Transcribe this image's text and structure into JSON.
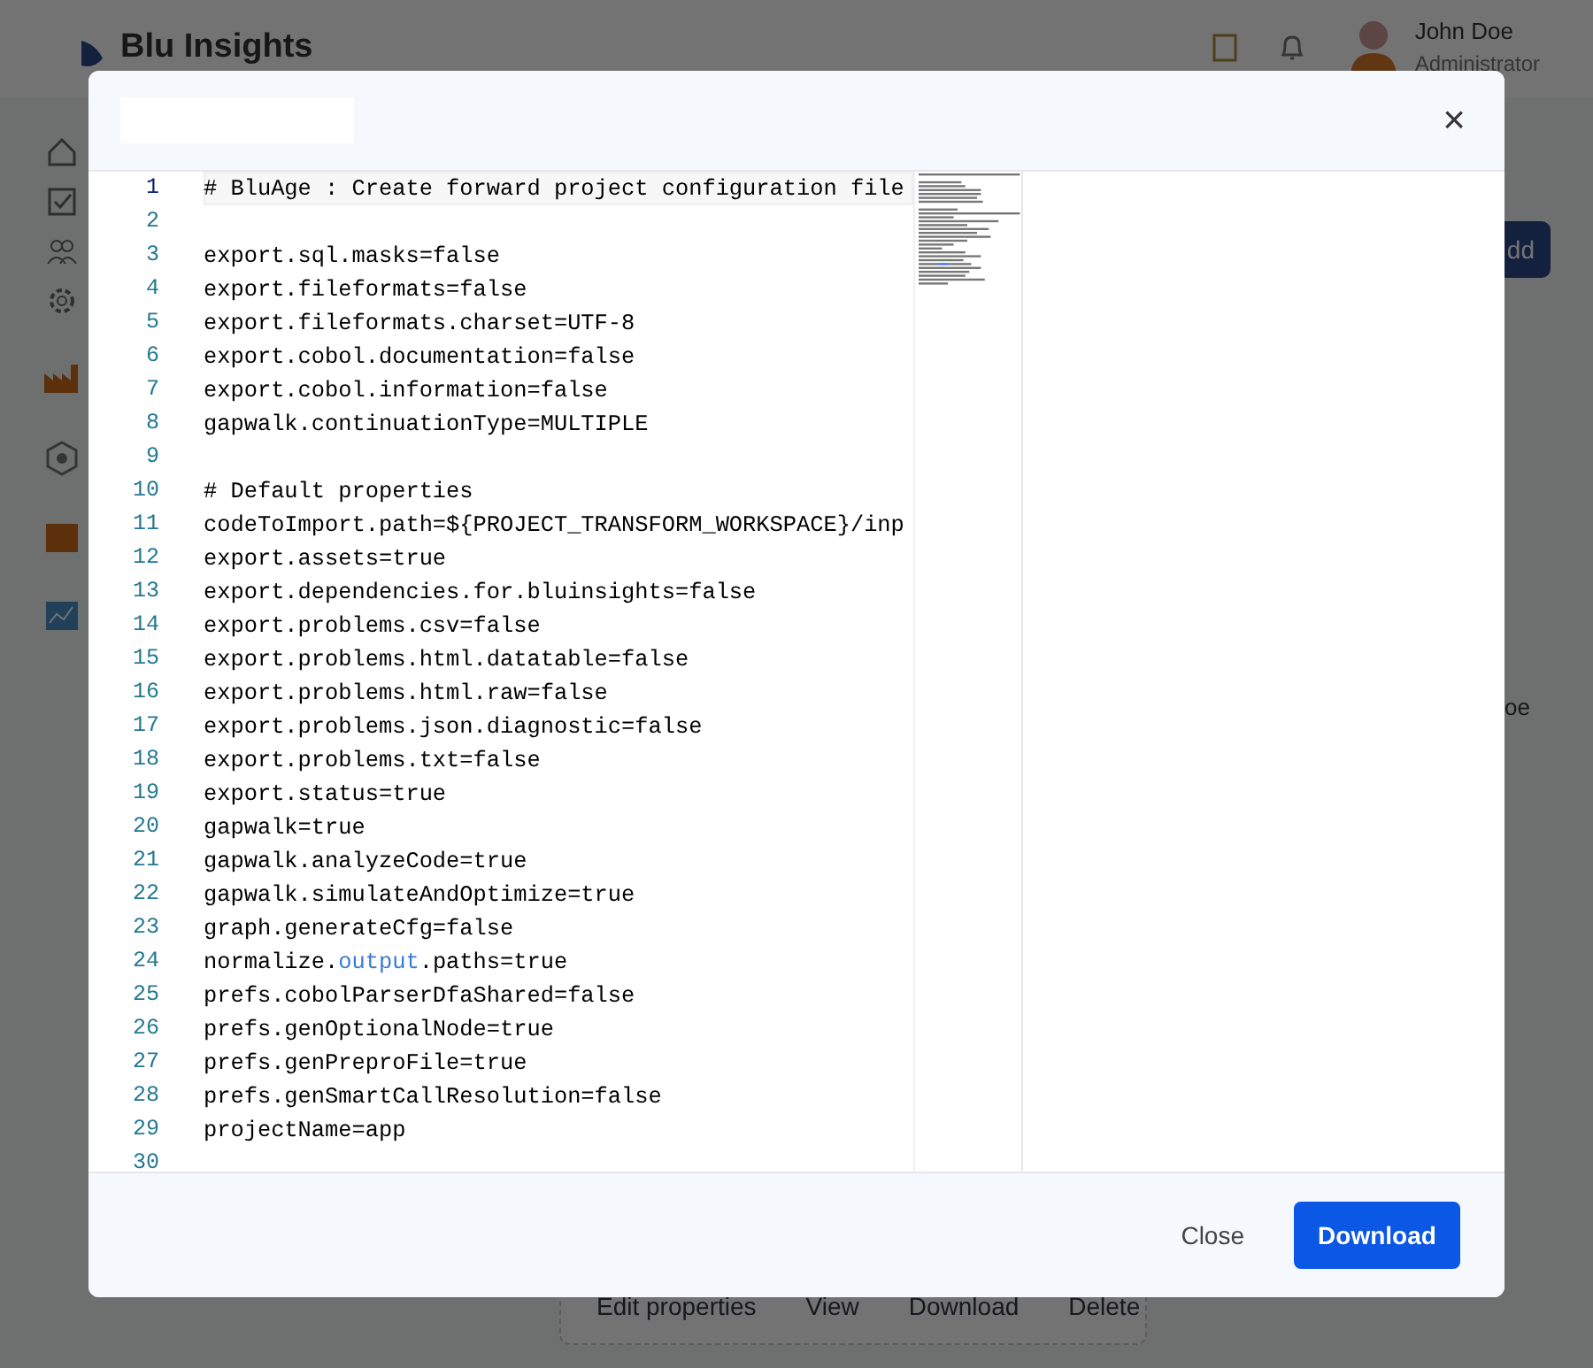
{
  "app": {
    "logo_text": "Blu Insights",
    "user": {
      "name": "John Doe",
      "role": "Administrator"
    },
    "add_button": "dd",
    "table_fragment": "oe",
    "actions": [
      "Edit properties",
      "View",
      "Download",
      "Delete"
    ]
  },
  "modal": {
    "close_symbol": "×",
    "editor": {
      "lines": [
        {
          "number": "1",
          "current": true,
          "segments": [
            {
              "text": "# BluAge : Create forward project configuration file"
            }
          ]
        },
        {
          "number": "2",
          "current": false
        },
        {
          "number": "3",
          "current": false,
          "segments": [
            {
              "text": "export.sql.masks=false"
            }
          ]
        },
        {
          "number": "4",
          "current": false,
          "segments": [
            {
              "text": "export.fileformats=false"
            }
          ]
        },
        {
          "number": "5",
          "current": false,
          "segments": [
            {
              "text": "export.fileformats.charset=UTF-8"
            }
          ]
        },
        {
          "number": "6",
          "current": false,
          "segments": [
            {
              "text": "export.cobol.documentation=false"
            }
          ]
        },
        {
          "number": "7",
          "current": false,
          "segments": [
            {
              "text": "export.cobol.information=false"
            }
          ]
        },
        {
          "number": "8",
          "current": false,
          "segments": [
            {
              "text": "gapwalk.continuationType=MULTIPLE"
            }
          ]
        },
        {
          "number": "9",
          "current": false
        },
        {
          "number": "10",
          "current": false,
          "segments": [
            {
              "text": "# Default properties"
            }
          ]
        },
        {
          "number": "11",
          "current": false,
          "segments": [
            {
              "text": "codeToImport.path=${PROJECT_TRANSFORM_WORKSPACE}/inp"
            }
          ]
        },
        {
          "number": "12",
          "current": false,
          "segments": [
            {
              "text": "export.assets=true"
            }
          ]
        },
        {
          "number": "13",
          "current": false,
          "segments": [
            {
              "text": "export.dependencies.for.bluinsights=false"
            }
          ]
        },
        {
          "number": "14",
          "current": false,
          "segments": [
            {
              "text": "export.problems.csv=false"
            }
          ]
        },
        {
          "number": "15",
          "current": false,
          "segments": [
            {
              "text": "export.problems.html.datatable=false"
            }
          ]
        },
        {
          "number": "16",
          "current": false,
          "segments": [
            {
              "text": "export.problems.html.raw=false"
            }
          ]
        },
        {
          "number": "17",
          "current": false,
          "segments": [
            {
              "text": "export.problems.json.diagnostic=false"
            }
          ]
        },
        {
          "number": "18",
          "current": false,
          "segments": [
            {
              "text": "export.problems.txt=false"
            }
          ]
        },
        {
          "number": "19",
          "current": false,
          "segments": [
            {
              "text": "export.status=true"
            }
          ]
        },
        {
          "number": "20",
          "current": false,
          "segments": [
            {
              "text": "gapwalk=true"
            }
          ]
        },
        {
          "number": "21",
          "current": false,
          "segments": [
            {
              "text": "gapwalk.analyzeCode=true"
            }
          ]
        },
        {
          "number": "22",
          "current": false,
          "segments": [
            {
              "text": "gapwalk.simulateAndOptimize=true"
            }
          ]
        },
        {
          "number": "23",
          "current": false,
          "segments": [
            {
              "text": "graph.generateCfg=false"
            }
          ]
        },
        {
          "number": "24",
          "current": false,
          "segments": [
            {
              "text": "normalize."
            },
            {
              "text": "output",
              "kind": "keyword"
            },
            {
              "text": ".paths=true"
            }
          ]
        },
        {
          "number": "25",
          "current": false,
          "segments": [
            {
              "text": "prefs.cobolParserDfaShared=false"
            }
          ]
        },
        {
          "number": "26",
          "current": false,
          "segments": [
            {
              "text": "prefs.genOptionalNode=true"
            }
          ]
        },
        {
          "number": "27",
          "current": false,
          "segments": [
            {
              "text": "prefs.genPreproFile=true"
            }
          ]
        },
        {
          "number": "28",
          "current": false,
          "segments": [
            {
              "text": "prefs.genSmartCallResolution=false"
            }
          ]
        },
        {
          "number": "29",
          "current": false,
          "segments": [
            {
              "text": "projectName=app"
            }
          ]
        },
        {
          "number": "30",
          "current": false
        }
      ]
    },
    "buttons": [
      {
        "label": "Close",
        "kind": "secondary"
      },
      {
        "label": "Download",
        "kind": "primary"
      }
    ]
  }
}
